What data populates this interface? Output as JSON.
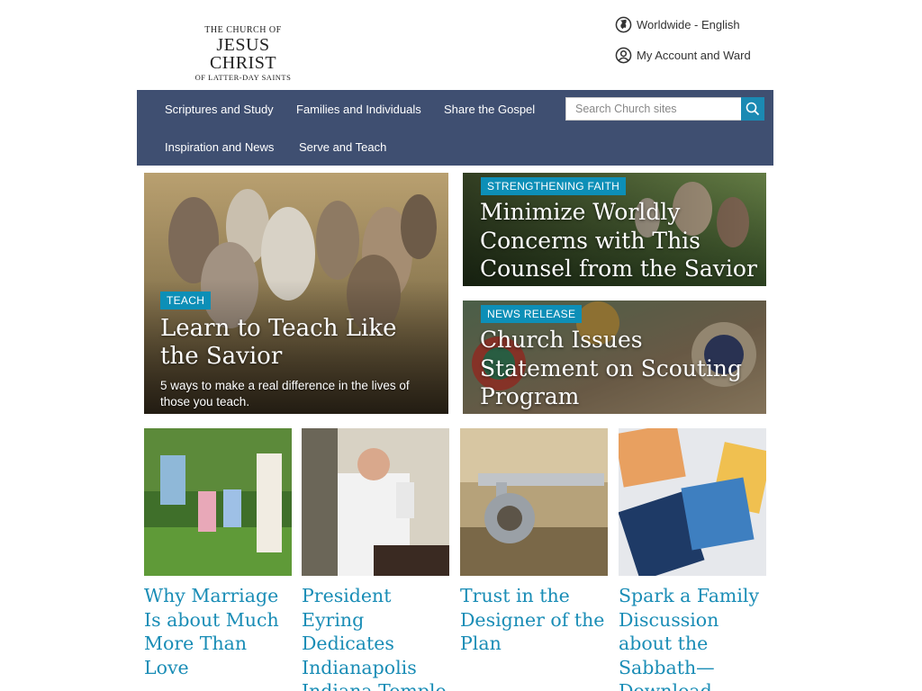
{
  "header": {
    "logo": {
      "line1": "THE CHURCH OF",
      "line2": "JESUS CHRIST",
      "line3": "OF LATTER-DAY SAINTS"
    },
    "language_label": "Worldwide - English",
    "language_icon": "globe-icon",
    "account_label": "My Account and Ward",
    "account_icon": "user-circle-icon"
  },
  "nav": {
    "items": [
      "Scriptures and Study",
      "Families and Individuals",
      "Share the Gospel",
      "Inspiration and News",
      "Serve and Teach"
    ],
    "search": {
      "placeholder": "Search Church sites",
      "value": "",
      "icon": "search-icon"
    },
    "colors": {
      "nav_bg": "#3f4f71",
      "accent": "#0d8fb7"
    }
  },
  "featured": {
    "main": {
      "tag": "TEACH",
      "title": "Learn to Teach Like the Savior",
      "subtitle": "5 ways to make a real difference in the lives of those you teach."
    },
    "side": [
      {
        "tag": "STRENGTHENING FAITH",
        "title": "Minimize Worldly Concerns with This Counsel from the Savior"
      },
      {
        "tag": "NEWS RELEASE",
        "title": "Church Issues Statement on Scouting Program"
      }
    ]
  },
  "tiles": [
    {
      "title": "Why Marriage Is about Much More Than Love"
    },
    {
      "title": "President Eyring Dedicates Indianapolis Indiana Temple"
    },
    {
      "title": "Trust in the Designer of the Plan"
    },
    {
      "title": "Spark a Family Discussion about the Sabbath—Download"
    }
  ]
}
